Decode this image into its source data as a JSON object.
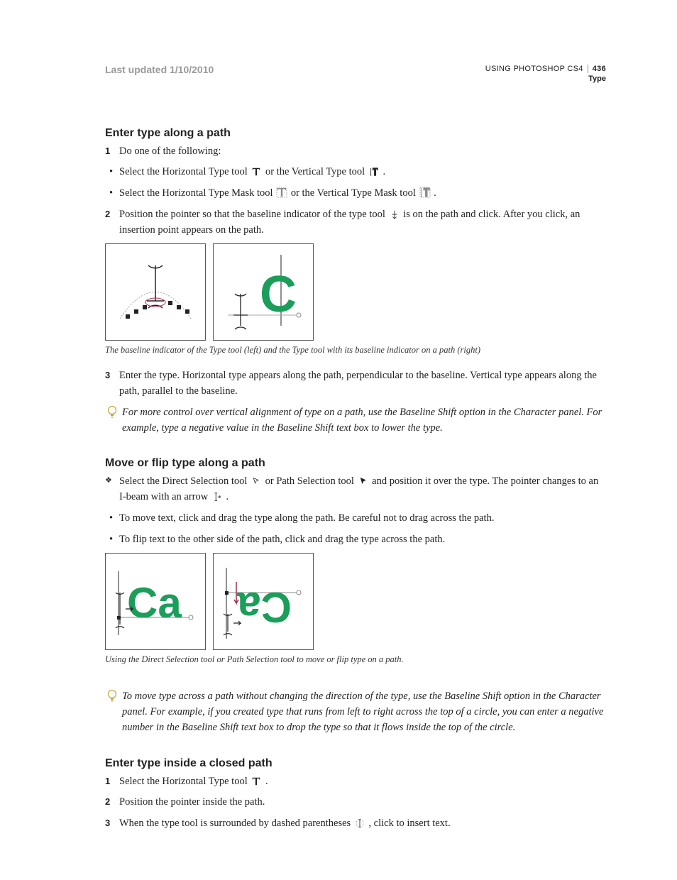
{
  "header": {
    "last_updated": "Last updated 1/10/2010",
    "doc_title": "USING PHOTOSHOP CS4",
    "page_number": "436",
    "section": "Type"
  },
  "sec1": {
    "heading": "Enter type along a path",
    "step1": "Do one of the following:",
    "b1_a": "Select the Horizontal Type tool ",
    "b1_b": " or the Vertical Type tool ",
    "b1_c": " .",
    "b2_a": "Select the Horizontal Type Mask tool ",
    "b2_b": " or the Vertical Type Mask tool ",
    "b2_c": ".",
    "step2_a": "Position the pointer so that the baseline indicator of the type tool ",
    "step2_b": " is on the path and click. After you click, an insertion point appears on the path.",
    "fig1_caption": "The baseline indicator of the Type tool (left) and the Type tool with its baseline indicator on a path (right)",
    "step3": "Enter the type. Horizontal type appears along the path, perpendicular to the baseline. Vertical type appears along the path, parallel to the baseline.",
    "tip": "For more control over vertical alignment of type on a path, use the Baseline Shift option in the Character panel. For example, type a negative value in the Baseline Shift text box to lower the type."
  },
  "sec2": {
    "heading": "Move or flip type along a path",
    "d1_a": "Select the Direct Selection tool ",
    "d1_b": " or Path Selection tool ",
    "d1_c": " and position it over the type. The pointer changes to an I-beam with an arrow ",
    "d1_d": ".",
    "b1": "To move text, click and drag the type along the path. Be careful not to drag across the path.",
    "b2": "To flip text to the other side of the path, click and drag the type across the path.",
    "fig2_caption": "Using the Direct Selection tool or Path Selection tool to move or flip type on a path.",
    "tip": "To move type across a path without changing the direction of the type, use the Baseline Shift option in the Character panel. For example, if you created type that runs from left to right across the top of a circle, you can enter a negative number in the Baseline Shift text box to drop the type so that it flows inside the top of the circle."
  },
  "sec3": {
    "heading": "Enter type inside a closed path",
    "step1_a": "Select the Horizontal Type tool ",
    "step1_b": " .",
    "step2": "Position the pointer inside the path.",
    "step3_a": "When the type tool is surrounded by dashed parentheses ",
    "step3_b": ", click to insert text."
  }
}
